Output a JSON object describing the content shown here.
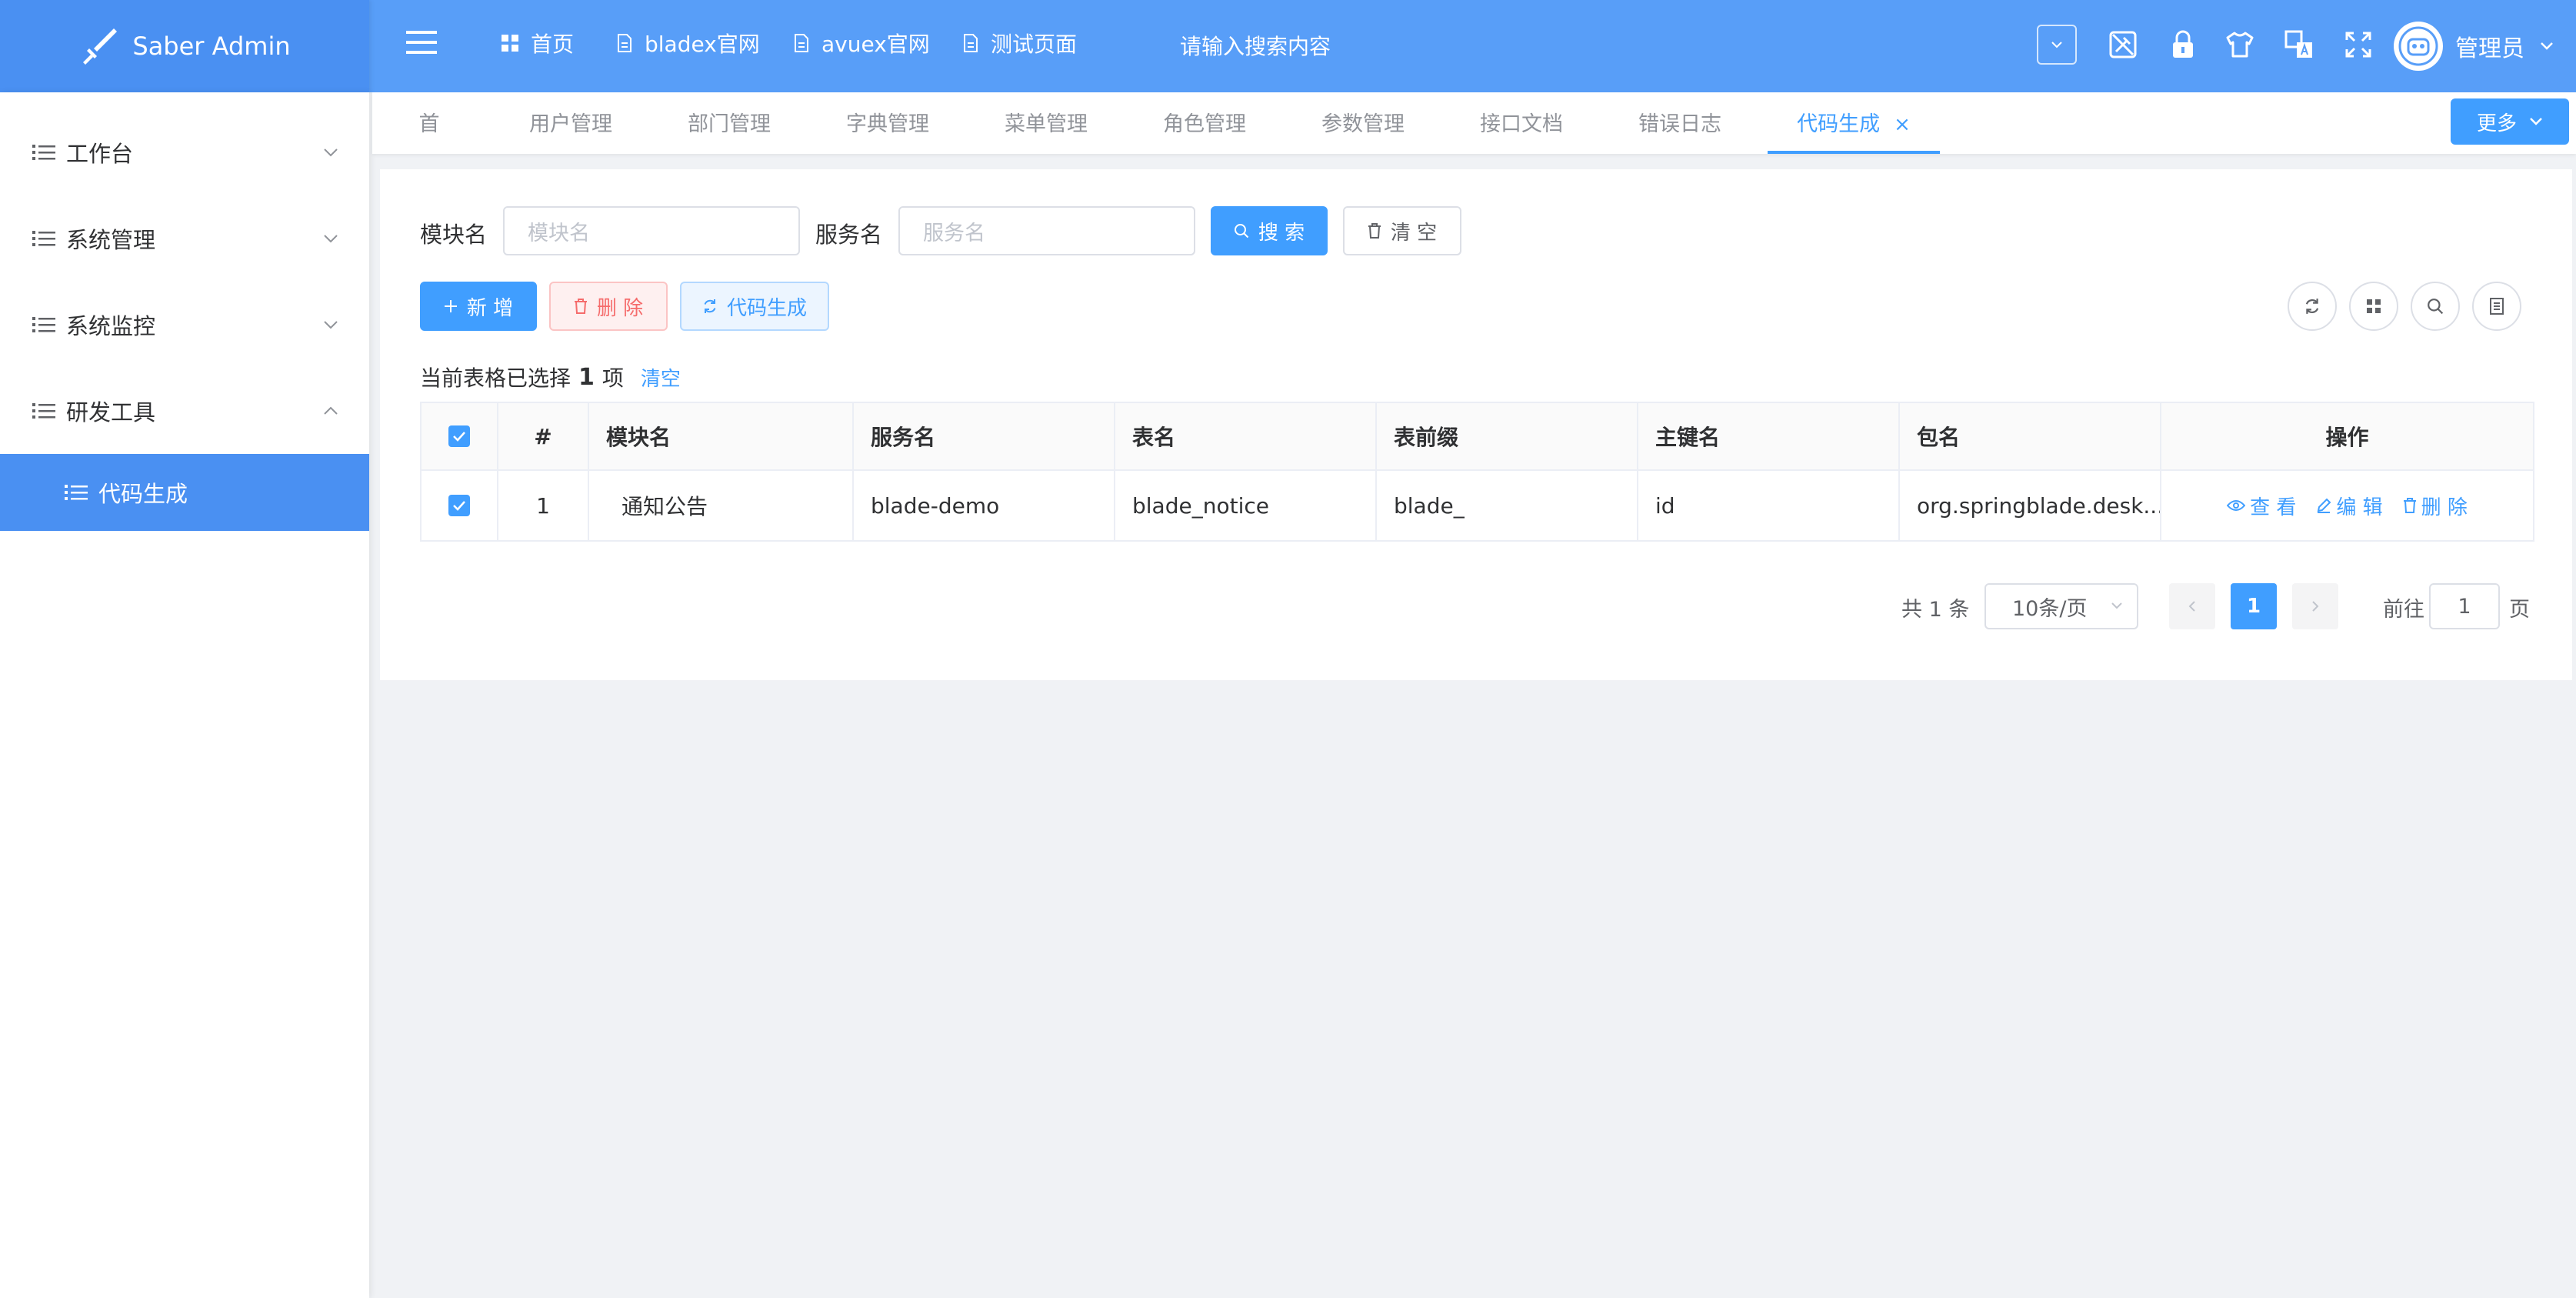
{
  "app": {
    "title": "Saber Admin"
  },
  "header": {
    "nav": [
      {
        "label": "首页",
        "icon": "grid-icon"
      },
      {
        "label": "bladex官网",
        "icon": "document-icon"
      },
      {
        "label": "avuex官网",
        "icon": "document-icon"
      },
      {
        "label": "测试页面",
        "icon": "document-icon"
      }
    ],
    "search_placeholder": "请输入搜索内容",
    "user_name": "管理员"
  },
  "sidebar": {
    "items": [
      {
        "label": "工作台",
        "expanded": false
      },
      {
        "label": "系统管理",
        "expanded": false
      },
      {
        "label": "系统监控",
        "expanded": false
      },
      {
        "label": "研发工具",
        "expanded": true
      }
    ],
    "active_sub": "代码生成"
  },
  "tabs": {
    "items": [
      "首页",
      "用户管理",
      "部门管理",
      "字典管理",
      "菜单管理",
      "角色管理",
      "参数管理",
      "接口文档",
      "错误日志",
      "代码生成"
    ],
    "active": "代码生成",
    "close_symbol": "×",
    "more_label": "更多"
  },
  "filters": {
    "module_label": "模块名",
    "module_placeholder": "模块名",
    "service_label": "服务名",
    "service_placeholder": "服务名",
    "search_button": "搜 索",
    "clear_button": "清 空"
  },
  "toolbar": {
    "add_button": "新 增",
    "delete_button": "删 除",
    "generate_button": "代码生成"
  },
  "selection": {
    "prefix": "当前表格已选择",
    "count": "1",
    "suffix": "项",
    "clear_link": "清空"
  },
  "table": {
    "columns": [
      "#",
      "模块名",
      "服务名",
      "表名",
      "表前缀",
      "主键名",
      "包名",
      "操作"
    ],
    "rows": [
      {
        "index": "1",
        "module": "通知公告",
        "service": "blade-demo",
        "table_name": "blade_notice",
        "prefix": "blade_",
        "pk": "id",
        "package": "org.springblade.desk...",
        "checked": true
      }
    ],
    "actions": {
      "view": "查 看",
      "edit": "编 辑",
      "delete": "删 除"
    }
  },
  "pagination": {
    "total_text": "共 1 条",
    "page_size": "10条/页",
    "current_page": "1",
    "goto_label": "前往",
    "goto_value": "1",
    "goto_suffix": "页"
  },
  "colors": {
    "header_bg": "#589ef8",
    "logo_bg": "#4a90f2",
    "primary": "#409eff",
    "danger": "#f56c6c",
    "page_bg": "#f0f2f5"
  }
}
